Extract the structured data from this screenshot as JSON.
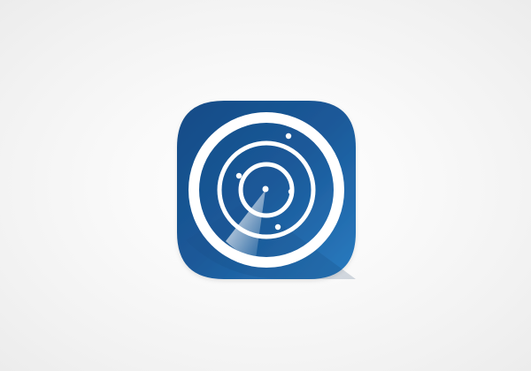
{
  "app_icon": {
    "name": "radar-app-icon",
    "colors": {
      "background": "#f5f5f5",
      "icon_dark": "#154b86",
      "icon_mid": "#1b5a9a",
      "icon_light": "#2a7cc1",
      "ring": "#ffffff",
      "radar_blips": "#ffffff"
    }
  }
}
